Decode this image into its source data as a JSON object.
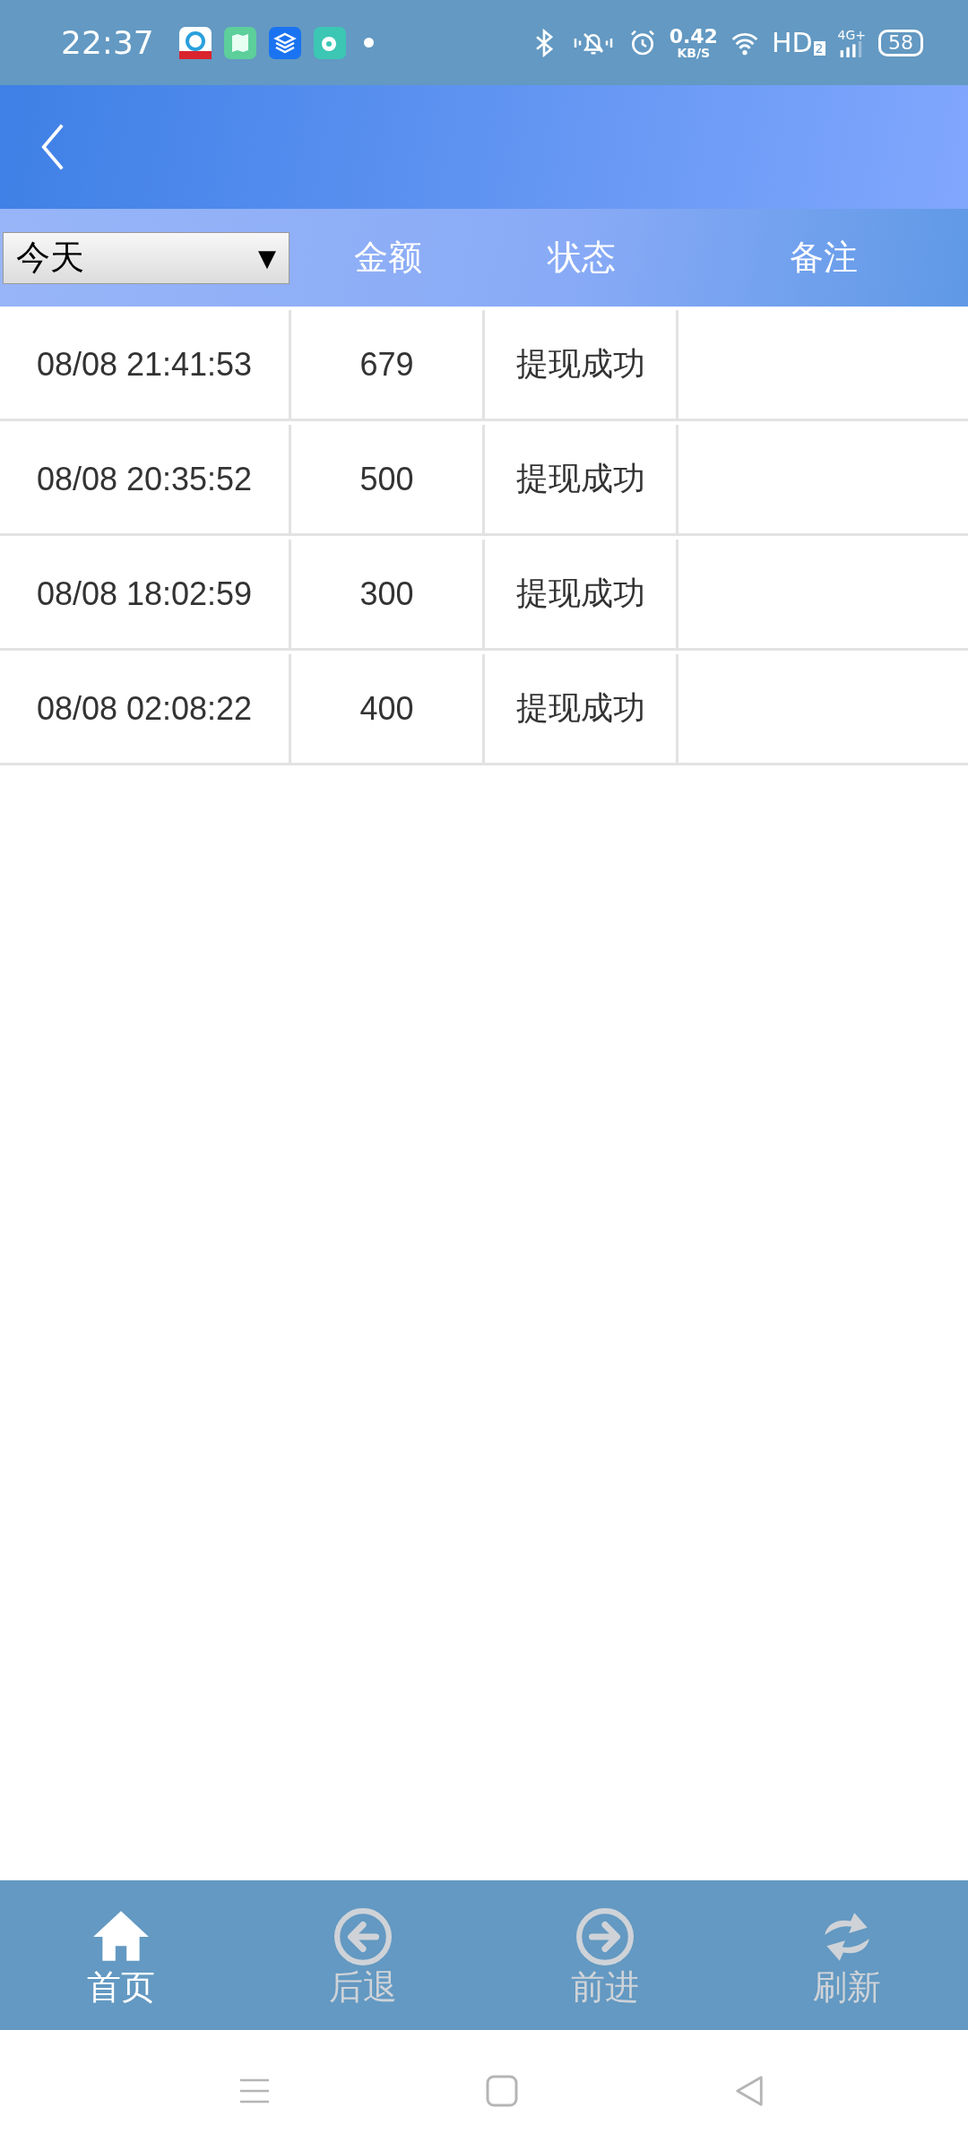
{
  "status_bar": {
    "time": "22:37",
    "net_speed": "0.42",
    "net_unit": "KB/S",
    "hd": "HD",
    "hd_sub": "2",
    "network": "4G+",
    "battery": "58"
  },
  "filter": {
    "value": "今天",
    "caret": "▼"
  },
  "table": {
    "columns": [
      "金额",
      "状态",
      "备注"
    ],
    "rows": [
      {
        "time": "08/08 21:41:53",
        "amount": "679",
        "status": "提现成功"
      },
      {
        "time": "08/08 20:35:52",
        "amount": "500",
        "status": "提现成功"
      },
      {
        "time": "08/08 18:02:59",
        "amount": "300",
        "status": "提现成功"
      },
      {
        "time": "08/08 02:08:22",
        "amount": "400",
        "status": "提现成功"
      }
    ]
  },
  "bottom_nav": [
    {
      "label": "首页",
      "kind": "home",
      "selected": true
    },
    {
      "label": "后退",
      "kind": "back",
      "selected": false
    },
    {
      "label": "前进",
      "kind": "forward",
      "selected": false
    },
    {
      "label": "刷新",
      "kind": "refresh",
      "selected": false
    }
  ]
}
